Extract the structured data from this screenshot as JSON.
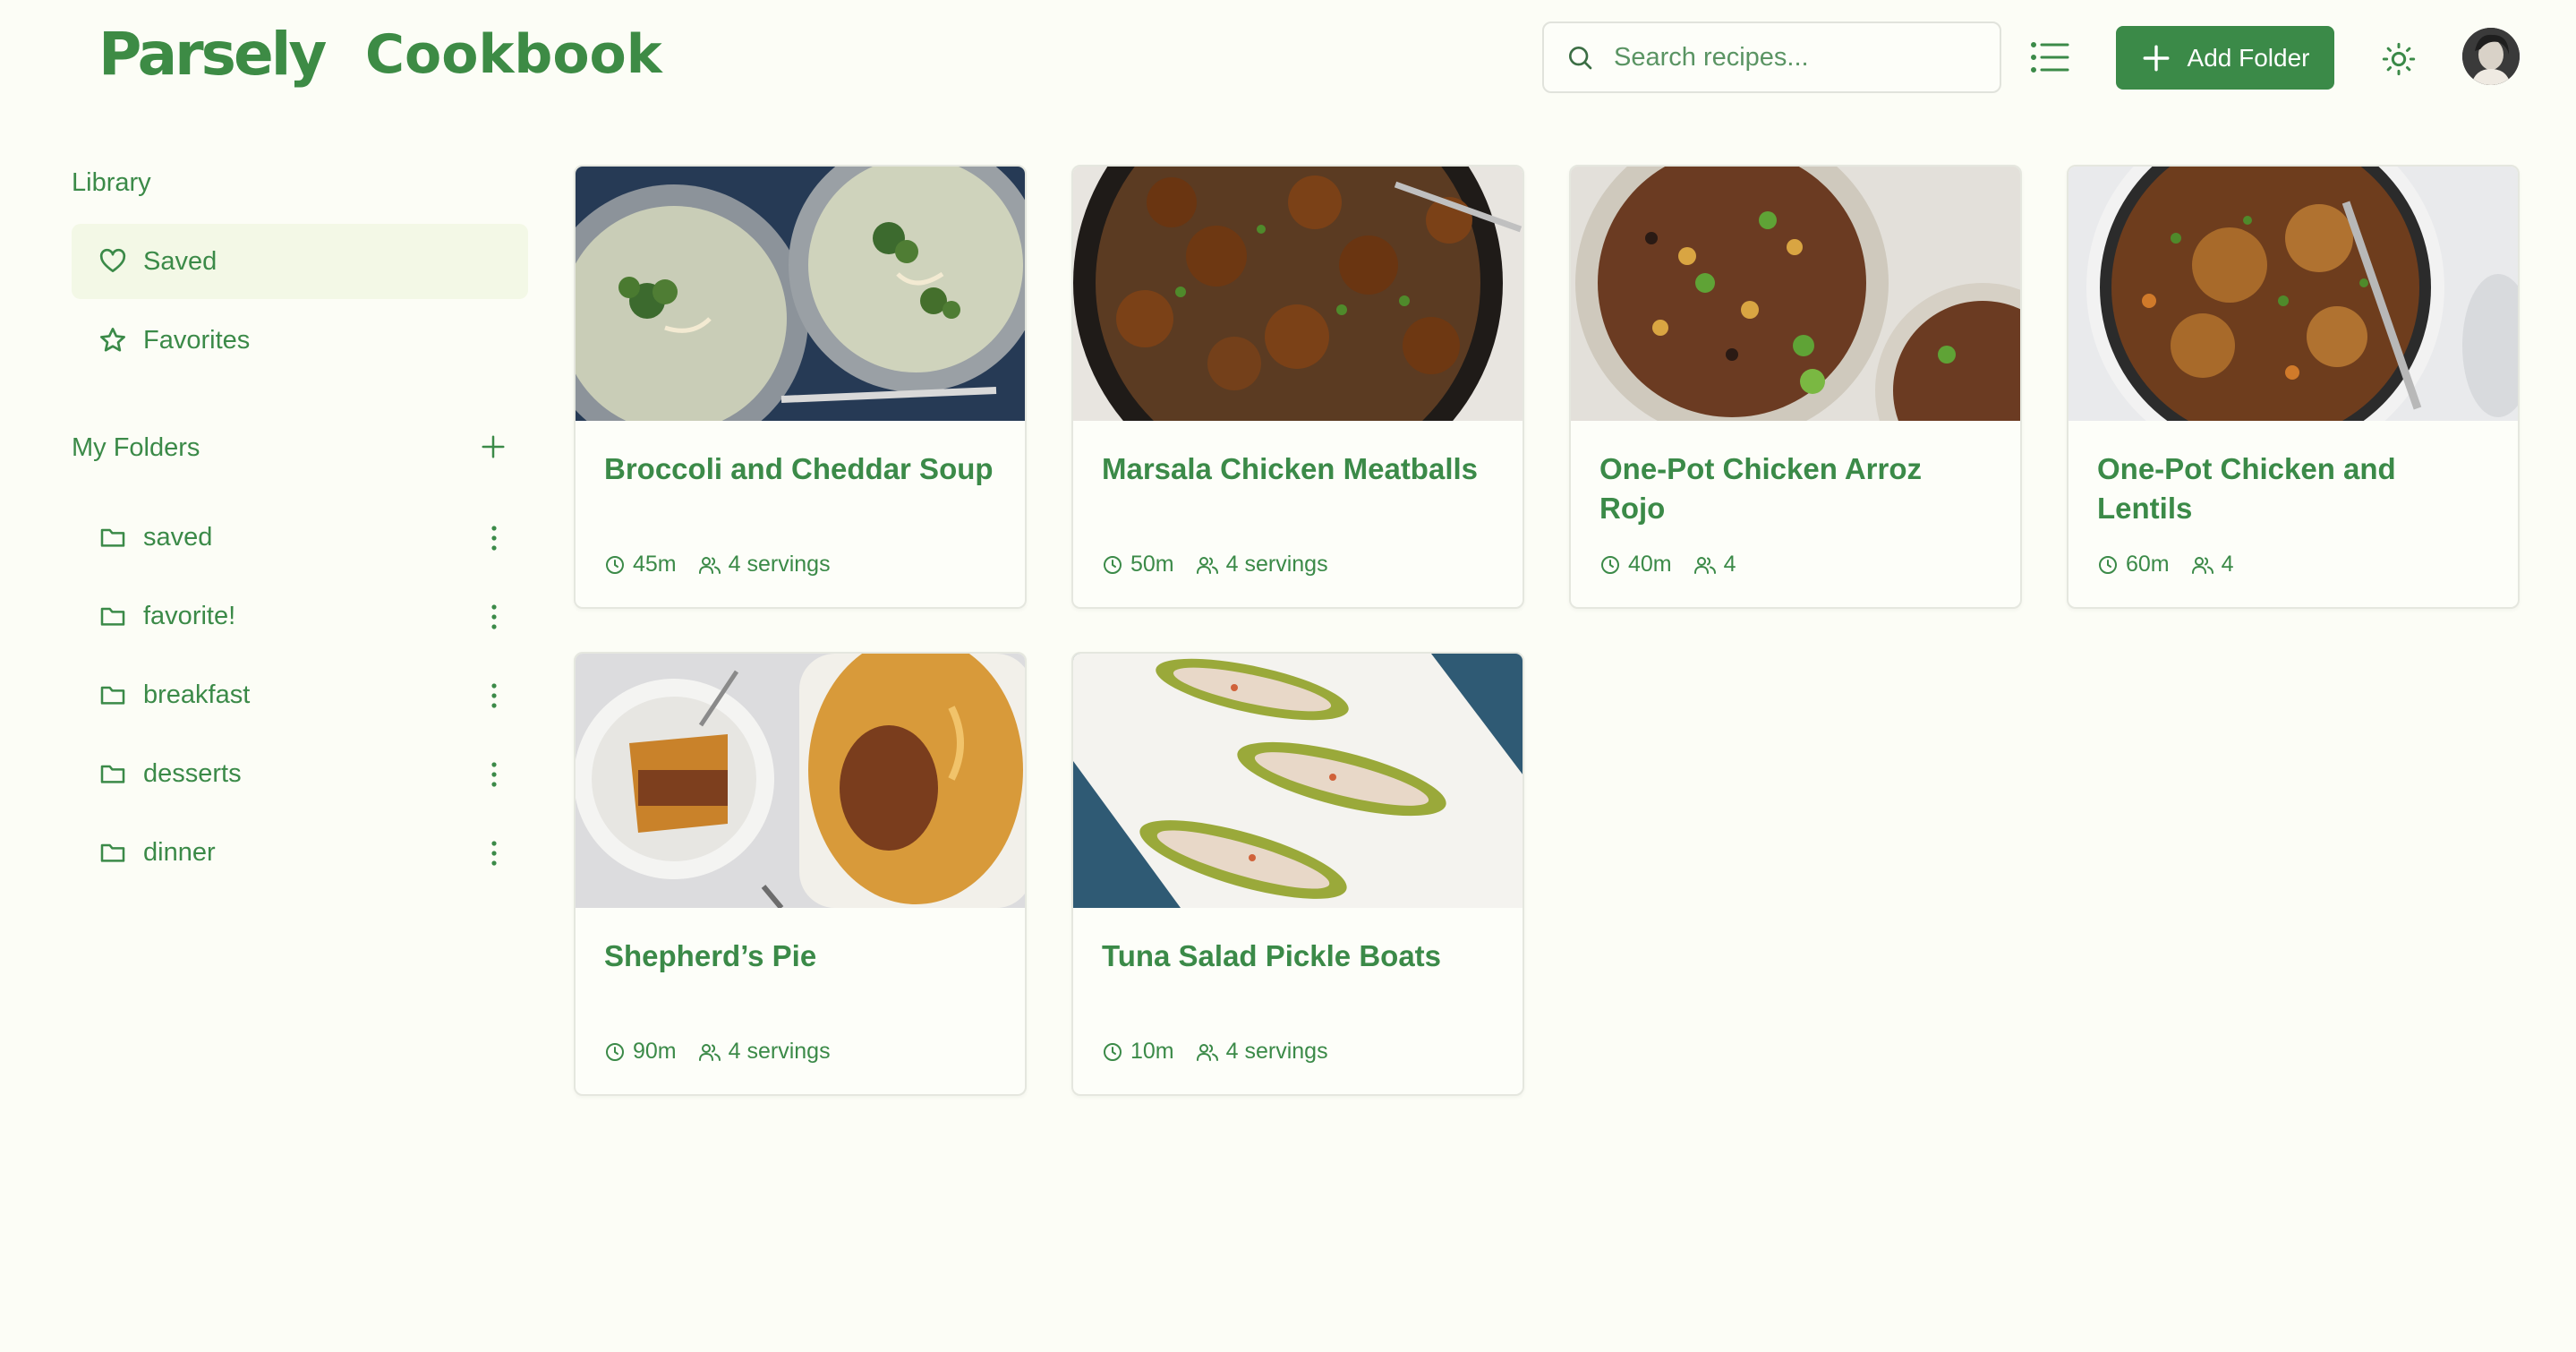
{
  "header": {
    "logo": "Parsely",
    "logo_sub": "Cookbook",
    "search_placeholder": "Search recipes...",
    "add_folder_label": "Add Folder"
  },
  "sidebar": {
    "library_title": "Library",
    "library_items": [
      {
        "label": "Saved",
        "icon": "heart-icon",
        "active": true
      },
      {
        "label": "Favorites",
        "icon": "star-icon",
        "active": false
      }
    ],
    "folders_title": "My Folders",
    "folders": [
      {
        "label": "saved"
      },
      {
        "label": "favorite!"
      },
      {
        "label": "breakfast"
      },
      {
        "label": "desserts"
      },
      {
        "label": "dinner"
      }
    ]
  },
  "recipes": [
    {
      "title": "Broccoli and Cheddar Soup",
      "time": "45m",
      "servings": "4 servings"
    },
    {
      "title": "Marsala Chicken Meatballs",
      "time": "50m",
      "servings": "4 servings"
    },
    {
      "title": "One-Pot Chicken Arroz Rojo",
      "time": "40m",
      "servings": "4"
    },
    {
      "title": "One-Pot Chicken and Lentils",
      "time": "60m",
      "servings": "4"
    },
    {
      "title": "Shepherd’s Pie",
      "time": "90m",
      "servings": "4 servings"
    },
    {
      "title": "Tuna Salad Pickle Boats",
      "time": "10m",
      "servings": "4 servings"
    }
  ],
  "colors": {
    "accent": "#3b8a48",
    "background": "#fcfdf6",
    "active_bg": "#f3f8e6"
  }
}
